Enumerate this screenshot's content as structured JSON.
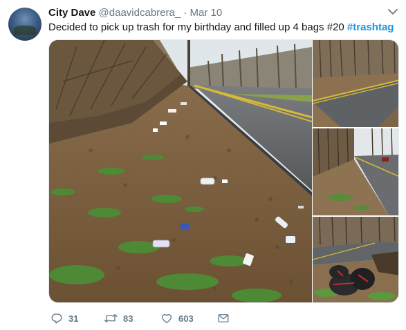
{
  "tweet": {
    "author_name": "City Dave",
    "author_handle": "@daavidcabrera_",
    "separator": "·",
    "date": "Mar 10",
    "text": "Decided to pick up trash for my birthday and filled up 4 bags #20",
    "hashtag": "#trashtag"
  },
  "actions": {
    "reply_count": "31",
    "retweet_count": "83",
    "like_count": "603"
  },
  "icons": {
    "caret": "chevron-down-icon",
    "reply": "comment-icon",
    "retweet": "retweet-icon",
    "like": "heart-icon",
    "message": "envelope-icon"
  },
  "colors": {
    "hashtag": "#1b95e0",
    "secondary_text": "#657786",
    "primary_text": "#14171a"
  }
}
